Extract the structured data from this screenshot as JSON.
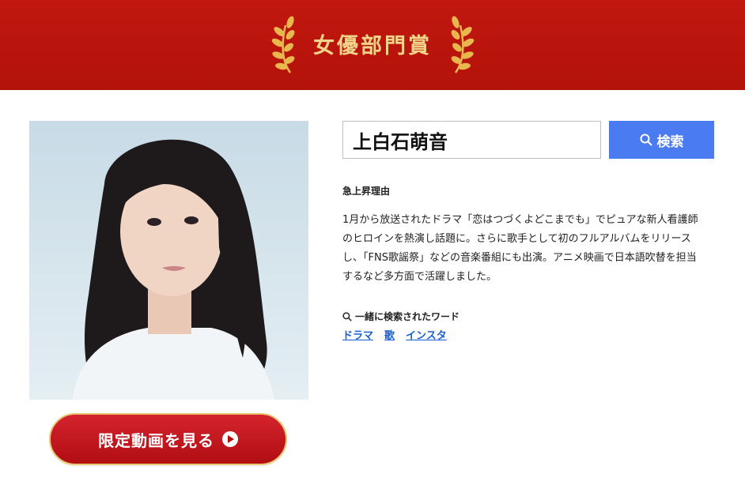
{
  "banner": {
    "title": "女優部門賞",
    "accent_color": "#f2d38a",
    "background_color": "#b3120a",
    "left_icon": "laurel-left-icon",
    "right_icon": "laurel-right-icon"
  },
  "profile": {
    "photo_alt": "上白石萌音",
    "cta_label": "限定動画を見る",
    "cta_icon": "play-circle-icon"
  },
  "search": {
    "value": "上白石萌音",
    "button_label": "検索",
    "button_icon": "search-icon"
  },
  "reason": {
    "heading": "急上昇理由",
    "text": "1月から放送されたドラマ「恋はつづくよどこまでも」でピュアな新人看護師\nのヒロインを熱演し話題に。さらに歌手として初のフルアルバムをリリース\nし、「FNS歌謡祭」などの音楽番組にも出演。アニメ映画で日本語吹替を担当\nするなど多方面で活躍しました。"
  },
  "related": {
    "heading": "一緒に検索されたワード",
    "icon": "search-icon",
    "words": [
      "ドラマ",
      "歌",
      "インスタ"
    ]
  }
}
